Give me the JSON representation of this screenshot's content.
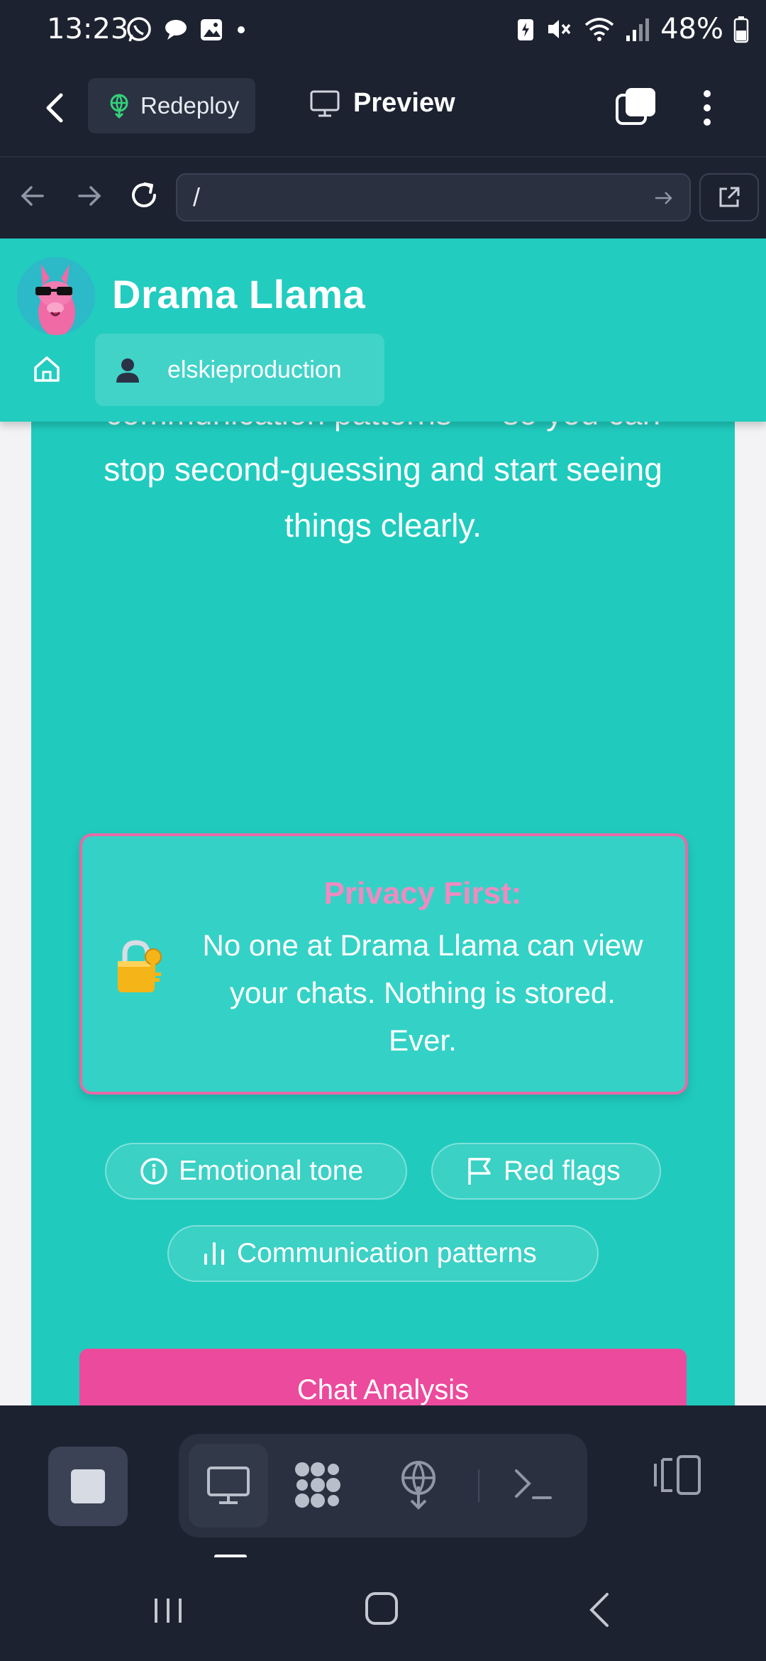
{
  "status_bar": {
    "time": "13:23",
    "battery_percent": "48%"
  },
  "app_header": {
    "redeploy_label": "Redeploy",
    "preview_label": "Preview"
  },
  "browser": {
    "url": "/"
  },
  "site": {
    "title": "Drama Llama",
    "username": "elskieproduction",
    "intro_text": "artificial intelligence to analyze your conversations privately — detecting emotional tone, 🚩 red flags, and communication patterns — so you can stop second-guessing and start seeing things clearly.",
    "privacy": {
      "title": "Privacy First:",
      "body": "No one at Drama Llama can view your chats. Nothing is stored. Ever."
    },
    "features": [
      {
        "label": "Emotional tone",
        "icon": "info-circle-icon"
      },
      {
        "label": "Red flags",
        "icon": "flag-icon"
      },
      {
        "label": "Communication patterns",
        "icon": "bar-chart-icon"
      }
    ],
    "cta_label": "Chat Analysis"
  },
  "colors": {
    "teal": "#22ccbf",
    "pink": "#ec4a9c",
    "dark": "#1d2230"
  }
}
